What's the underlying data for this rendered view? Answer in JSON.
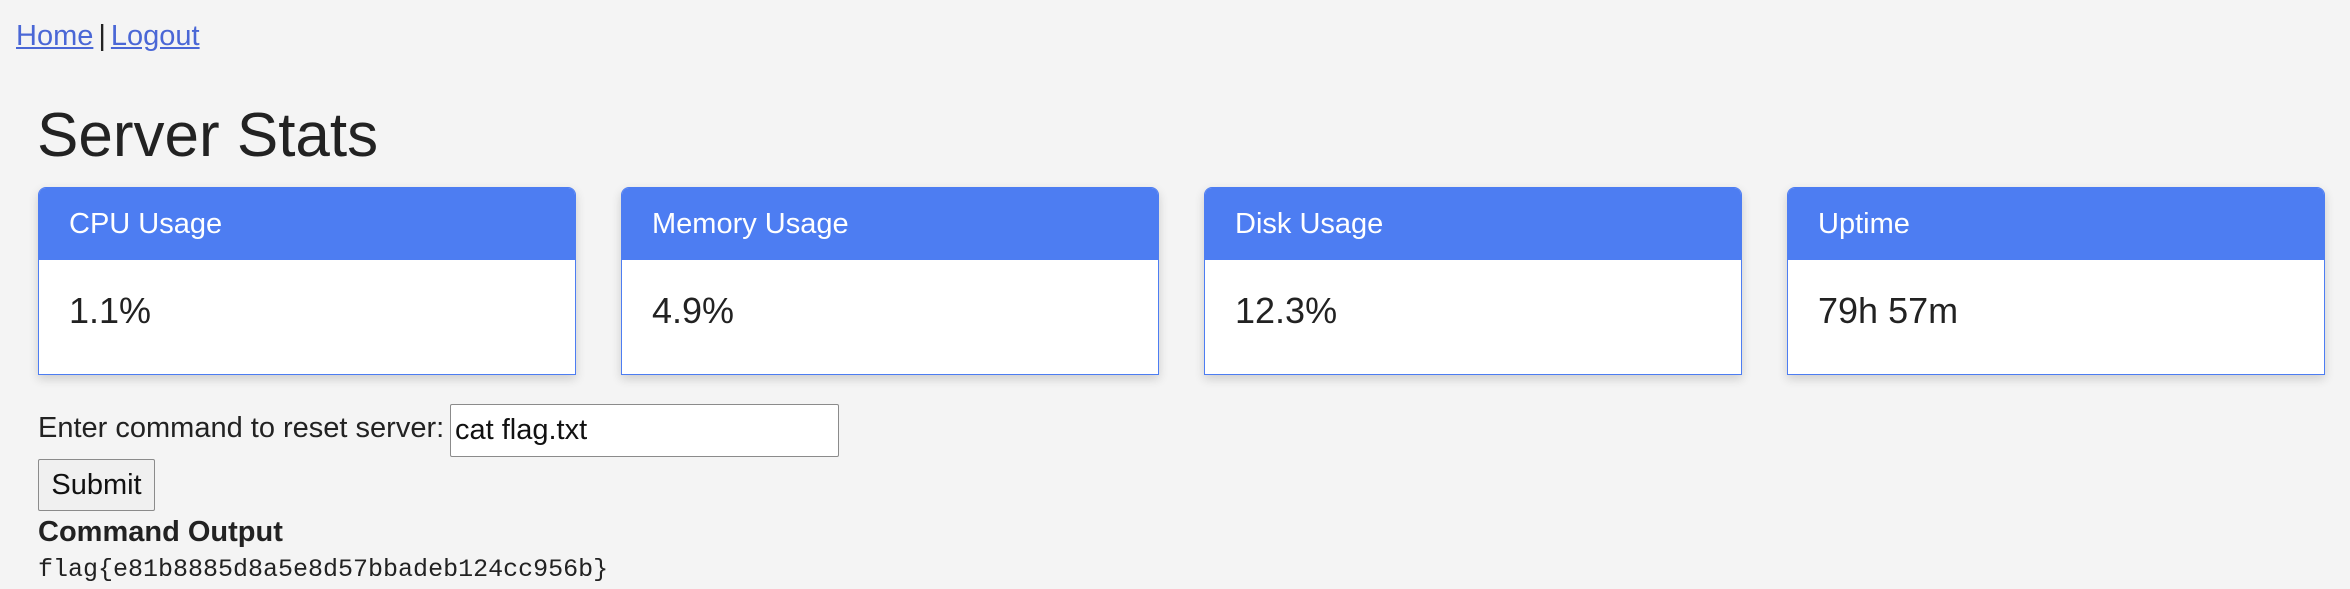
{
  "nav": {
    "home_label": "Home",
    "separator": "|",
    "logout_label": "Logout"
  },
  "page": {
    "title": "Server Stats"
  },
  "stats": [
    {
      "label": "CPU Usage",
      "value": "1.1%"
    },
    {
      "label": "Memory Usage",
      "value": "4.9%"
    },
    {
      "label": "Disk Usage",
      "value": "12.3%"
    },
    {
      "label": "Uptime",
      "value": "79h 57m"
    }
  ],
  "command": {
    "label": "Enter command to reset server:",
    "value": "cat flag.txt",
    "submit_label": "Submit"
  },
  "output": {
    "heading": "Command Output",
    "text": "flag{e81b8885d8a5e8d57bbadeb124cc956b}"
  },
  "colors": {
    "accent": "#4d7df2",
    "link": "#4a67d6",
    "background": "#f4f4f4"
  }
}
